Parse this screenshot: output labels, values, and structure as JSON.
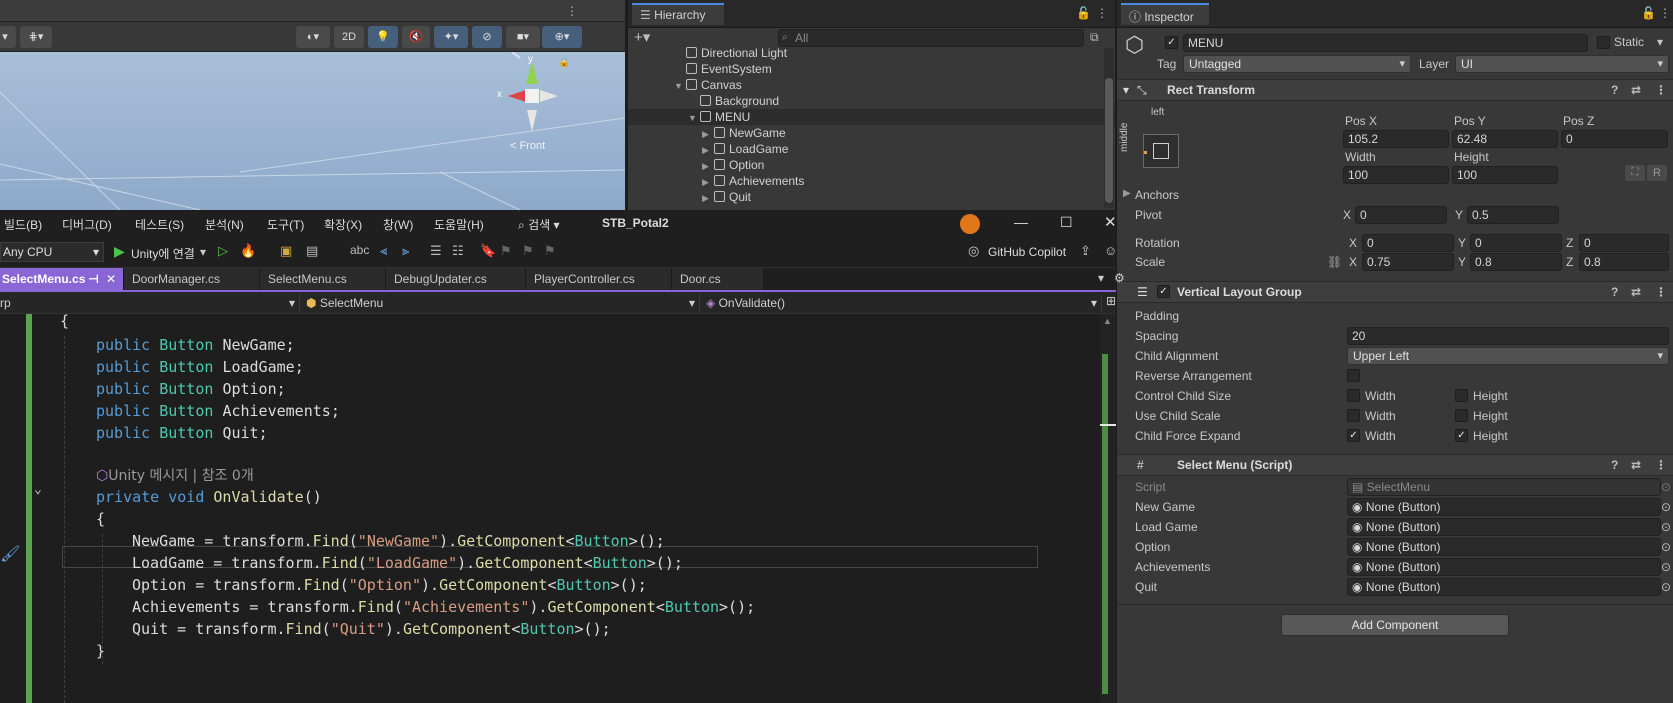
{
  "scene": {
    "toolbar_buttons": [
      "2D"
    ],
    "gizmo": {
      "x_label": "x",
      "y_label": "y",
      "view_label": "< Front"
    }
  },
  "hierarchy": {
    "tab_title": "Hierarchy",
    "search_placeholder": "All",
    "items": [
      {
        "label": "Directional Light"
      },
      {
        "label": "EventSystem"
      },
      {
        "label": "Canvas"
      },
      {
        "label": "Background"
      },
      {
        "label": "MENU"
      },
      {
        "label": "NewGame"
      },
      {
        "label": "LoadGame"
      },
      {
        "label": "Option"
      },
      {
        "label": "Achievements"
      },
      {
        "label": "Quit"
      }
    ]
  },
  "inspector": {
    "tab_title": "Inspector",
    "object_name": "MENU",
    "static_label": "Static",
    "tag_label": "Tag",
    "tag_value": "Untagged",
    "layer_label": "Layer",
    "layer_value": "UI",
    "rect_transform": {
      "title": "Rect Transform",
      "anchor_h": "left",
      "anchor_v": "middle",
      "pos_x_label": "Pos X",
      "pos_x": "105.2",
      "pos_y_label": "Pos Y",
      "pos_y": "62.48",
      "pos_z_label": "Pos Z",
      "pos_z": "0",
      "width_label": "Width",
      "width": "100",
      "height_label": "Height",
      "height": "100",
      "r_button": "R",
      "anchors_label": "Anchors",
      "pivot_label": "Pivot",
      "pivot_x": "0",
      "pivot_y": "0.5",
      "rotation_label": "Rotation",
      "rot_x": "0",
      "rot_y": "0",
      "rot_z": "0",
      "scale_label": "Scale",
      "scale_x": "0.75",
      "scale_y": "0.8",
      "scale_z": "0.8",
      "x": "X",
      "y": "Y",
      "z": "Z"
    },
    "vlg": {
      "title": "Vertical Layout Group",
      "padding_label": "Padding",
      "spacing_label": "Spacing",
      "spacing": "20",
      "child_alignment_label": "Child Alignment",
      "child_alignment": "Upper Left",
      "reverse_label": "Reverse Arrangement",
      "control_size_label": "Control Child Size",
      "use_scale_label": "Use Child Scale",
      "force_expand_label": "Child Force Expand",
      "width_label": "Width",
      "height_label": "Height"
    },
    "select_menu": {
      "title": "Select Menu (Script)",
      "script_label": "Script",
      "script_value": "SelectMenu",
      "fields": [
        {
          "label": "New Game",
          "value": "None (Button)"
        },
        {
          "label": "Load Game",
          "value": "None (Button)"
        },
        {
          "label": "Option",
          "value": "None (Button)"
        },
        {
          "label": "Achievements",
          "value": "None (Button)"
        },
        {
          "label": "Quit",
          "value": "None (Button)"
        }
      ]
    },
    "add_component": "Add Component"
  },
  "vs": {
    "menu": [
      "빌드(B)",
      "디버그(D)",
      "테스트(S)",
      "분석(N)",
      "도구(T)",
      "확장(X)",
      "창(W)",
      "도움말(H)"
    ],
    "search_label": "검색",
    "solution_name": "STB_Potal2",
    "platform": "Any CPU",
    "run_label": "Unity에 연결",
    "copilot_label": "GitHub Copilot",
    "tabs": [
      {
        "label": "SelectMenu.cs"
      },
      {
        "label": "DoorManager.cs"
      },
      {
        "label": "SelectMenu.cs"
      },
      {
        "label": "DebugUpdater.cs"
      },
      {
        "label": "PlayerController.cs"
      },
      {
        "label": "Door.cs"
      }
    ],
    "nav_left": "rp",
    "nav_class": "SelectMenu",
    "nav_member": "OnValidate()",
    "code": {
      "brace_open": "{",
      "fields": [
        "NewGame",
        "LoadGame",
        "Option",
        "Achievements",
        "Quit"
      ],
      "kw_public": "public",
      "kw_private": "private",
      "kw_void": "void",
      "type_button": "Button",
      "codelens": "Unity 메시지 | 참조 0개",
      "method_name": "OnValidate",
      "transform": "transform",
      "find": "Find",
      "get_component": "GetComponent",
      "brace_close": "}"
    }
  }
}
